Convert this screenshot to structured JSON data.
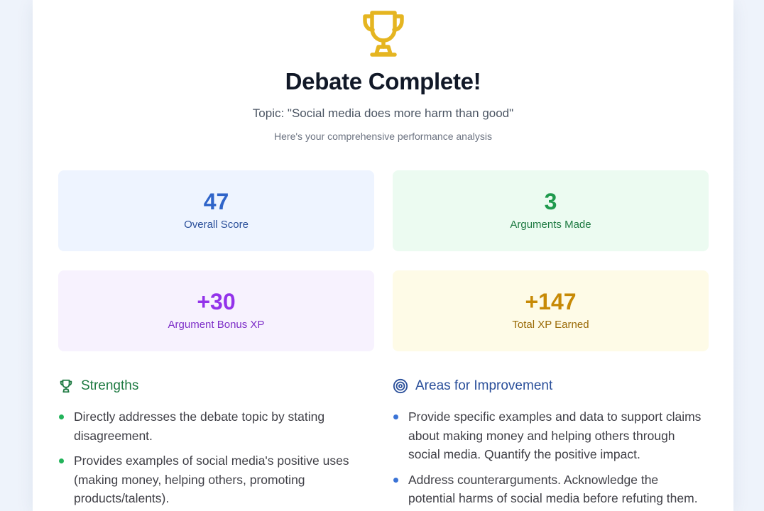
{
  "header": {
    "title": "Debate Complete!",
    "topic": "Topic: \"Social media does more harm than good\"",
    "subtitle": "Here's your comprehensive performance analysis",
    "trophy_icon": "trophy-icon"
  },
  "stats": {
    "overall_score": {
      "value": "47",
      "label": "Overall Score",
      "color": "#2f64c9"
    },
    "arguments_made": {
      "value": "3",
      "label": "Arguments Made",
      "color": "#1f9a4d"
    },
    "argument_bonus": {
      "value": "+30",
      "label": "Argument Bonus XP",
      "color": "#9333ea"
    },
    "total_xp": {
      "value": "+147",
      "label": "Total XP Earned",
      "color": "#c78a06"
    }
  },
  "strengths": {
    "heading": "Strengths",
    "icon": "trophy-icon",
    "items": [
      "Directly addresses the debate topic by stating disagreement.",
      "Provides examples of social media's positive uses (making money, helping others, promoting products/talents)."
    ]
  },
  "improvements": {
    "heading": "Areas for Improvement",
    "icon": "target-icon",
    "items": [
      "Provide specific examples and data to support claims about making money and helping others through social media. Quantify the positive impact.",
      "Address counterarguments. Acknowledge the potential harms of social media before refuting them."
    ]
  }
}
